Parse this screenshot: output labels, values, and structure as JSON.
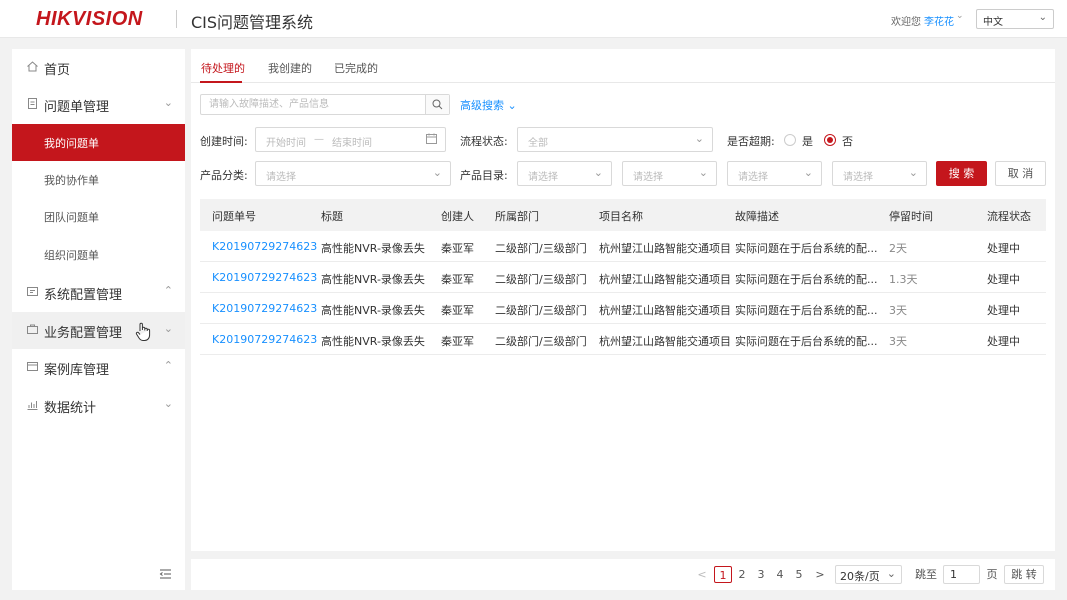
{
  "header": {
    "logo": "HIKVISION",
    "app_title": "CIS问题管理系统",
    "welcome": "欢迎您",
    "user": "李花花",
    "language": "中文",
    "brand_color": "#c4161c"
  },
  "sidebar": {
    "items": [
      {
        "label": "首页",
        "icon": "home-icon"
      },
      {
        "label": "问题单管理",
        "icon": "document-icon"
      },
      {
        "label": "系统配置管理",
        "icon": "settings-icon"
      },
      {
        "label": "业务配置管理",
        "icon": "briefcase-icon"
      },
      {
        "label": "案例库管理",
        "icon": "library-icon"
      },
      {
        "label": "数据统计",
        "icon": "bar-chart-icon"
      }
    ],
    "sub_items": [
      {
        "label": "我的问题单",
        "active": true
      },
      {
        "label": "我的协作单"
      },
      {
        "label": "团队问题单"
      },
      {
        "label": "组织问题单"
      }
    ]
  },
  "tabs": [
    {
      "label": "待处理的",
      "active": true
    },
    {
      "label": "我创建的"
    },
    {
      "label": "已完成的"
    }
  ],
  "search": {
    "placeholder": "请输入故障描述、产品信息",
    "advanced_label": "高级搜索"
  },
  "filters": {
    "created_time_label": "创建时间:",
    "start_placeholder": "开始时间",
    "range_sep": "—",
    "end_placeholder": "结束时间",
    "status_label": "流程状态:",
    "status_value": "全部",
    "overdue_label": "是否超期:",
    "overdue_yes": "是",
    "overdue_no": "否",
    "overdue_selected": "否",
    "category_label": "产品分类:",
    "category_placeholder": "请选择",
    "catalog_label": "产品目录:",
    "catalog_placeholder": "请选择",
    "search_button": "搜 索",
    "cancel_button": "取 消"
  },
  "table": {
    "columns": [
      "问题单号",
      "标题",
      "创建人",
      "所属部门",
      "项目名称",
      "故障描述",
      "停留时间",
      "流程状态"
    ],
    "rows": [
      [
        "K20190729274623",
        "高性能NVR-录像丢失",
        "秦亚军",
        "二级部门/三级部门",
        "杭州望江山路智能交通项目",
        "实际问题在于后台系统的配...",
        "2天",
        "处理中"
      ],
      [
        "K20190729274623",
        "高性能NVR-录像丢失",
        "秦亚军",
        "二级部门/三级部门",
        "杭州望江山路智能交通项目",
        "实际问题在于后台系统的配...",
        "1.3天",
        "处理中"
      ],
      [
        "K20190729274623",
        "高性能NVR-录像丢失",
        "秦亚军",
        "二级部门/三级部门",
        "杭州望江山路智能交通项目",
        "实际问题在于后台系统的配...",
        "3天",
        "处理中"
      ],
      [
        "K20190729274623",
        "高性能NVR-录像丢失",
        "秦亚军",
        "二级部门/三级部门",
        "杭州望江山路智能交通项目",
        "实际问题在于后台系统的配...",
        "3天",
        "处理中"
      ]
    ]
  },
  "pagination": {
    "prev": "<",
    "pages": [
      "1",
      "2",
      "3",
      "4",
      "5"
    ],
    "current": "1",
    "next": ">",
    "page_size": "20条/页",
    "jump_label": "跳至",
    "jump_value": "1",
    "page_unit": "页",
    "go_button": "跳 转"
  }
}
